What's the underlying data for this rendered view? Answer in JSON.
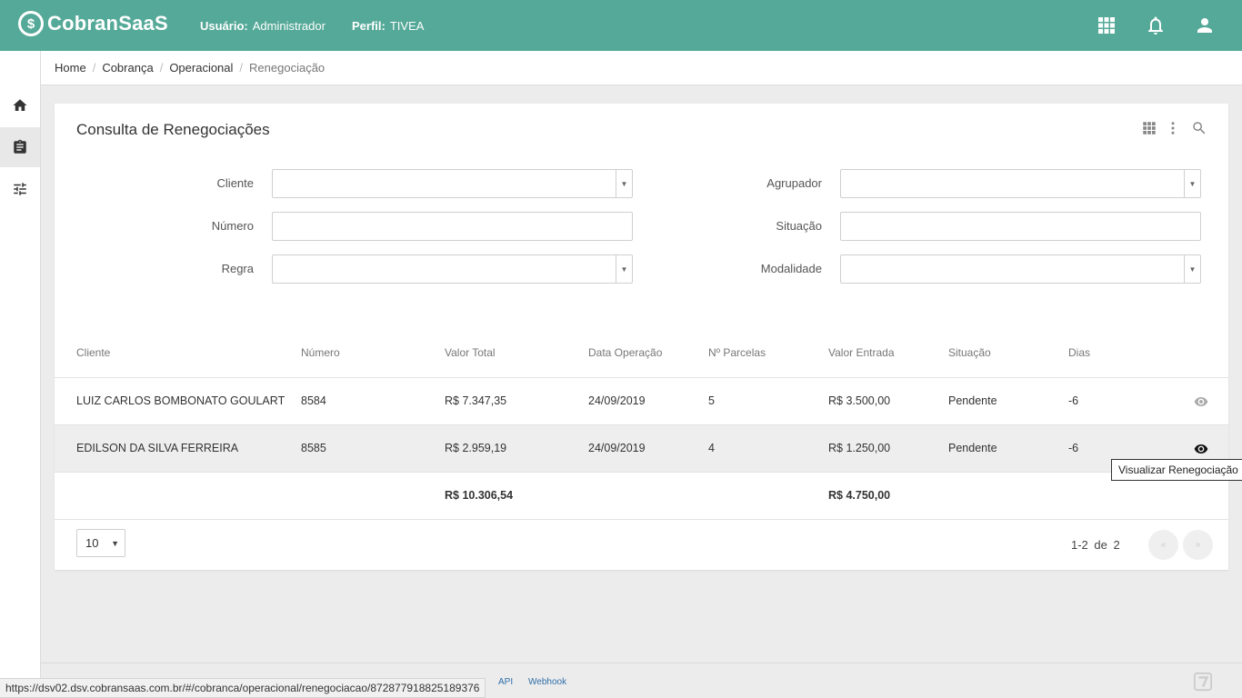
{
  "header": {
    "brand": "CobranSaaS",
    "user_label": "Usuário:",
    "user_value": "Administrador",
    "profile_label": "Perfil:",
    "profile_value": "TIVEA",
    "icons": [
      "apps-grid-icon",
      "bell-icon",
      "user-account-icon"
    ],
    "bg_color": "#55a998"
  },
  "sidebar": {
    "items": [
      {
        "name": "home",
        "icon": "home-icon"
      },
      {
        "name": "clipboard",
        "icon": "clipboard-icon",
        "active": true
      },
      {
        "name": "tune",
        "icon": "tune-sliders-icon"
      }
    ]
  },
  "breadcrumb": {
    "items": [
      "Home",
      "Cobrança",
      "Operacional"
    ],
    "current": "Renegociação"
  },
  "card": {
    "title": "Consulta de Renegociações",
    "tools": [
      "grid-view-icon",
      "more-vert-icon",
      "search-icon"
    ]
  },
  "filters": {
    "cliente": {
      "label": "Cliente",
      "value": ""
    },
    "numero": {
      "label": "Número",
      "value": ""
    },
    "regra": {
      "label": "Regra",
      "value": ""
    },
    "agrupador": {
      "label": "Agrupador",
      "value": ""
    },
    "situacao": {
      "label": "Situação",
      "value": ""
    },
    "modalidade": {
      "label": "Modalidade",
      "value": ""
    }
  },
  "table": {
    "headers": [
      "Cliente",
      "Número",
      "Valor Total",
      "Data Operação",
      "Nº Parcelas",
      "Valor Entrada",
      "Situação",
      "Dias"
    ],
    "rows": [
      [
        "LUIZ CARLOS BOMBONATO GOULART",
        "8584",
        "R$ 7.347,35",
        "24/09/2019",
        "5",
        "R$ 3.500,00",
        "Pendente",
        "-6"
      ],
      [
        "EDILSON DA SILVA FERREIRA",
        "8585",
        "R$ 2.959,19",
        "24/09/2019",
        "4",
        "R$ 1.250,00",
        "Pendente",
        "-6"
      ]
    ],
    "totals": {
      "valor_total": "R$ 10.306,54",
      "valor_entrada": "R$ 4.750,00"
    },
    "row_action_icon": "eye-icon"
  },
  "tooltip": "Visualizar Renegociação",
  "pager": {
    "page_size": "10",
    "range": "1-2",
    "of_label": "de",
    "total": "2",
    "prev": "«",
    "next": "»"
  },
  "footer": {
    "links": [
      "API",
      "Webhook"
    ],
    "status_url": "https://dsv02.dsv.cobransaas.com.br/#/cobranca/operacional/renegociacao/872877918825189376"
  }
}
